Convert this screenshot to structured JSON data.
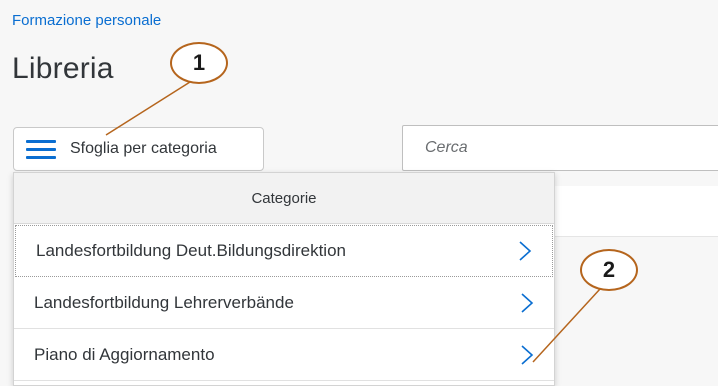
{
  "header": {
    "breadcrumb": "Formazione personale",
    "title": "Libreria"
  },
  "toolbar": {
    "browse_label": "Sfoglia per categoria",
    "search_placeholder": "Cerca"
  },
  "categories": {
    "header": "Categorie",
    "items": [
      {
        "label": "Landesfortbildung Deut.Bildungsdirektion"
      },
      {
        "label": "Landesfortbildung Lehrerverbände"
      },
      {
        "label": "Piano di Aggiornamento"
      }
    ]
  },
  "callouts": [
    {
      "number": "1"
    },
    {
      "number": "2"
    }
  ],
  "colors": {
    "link": "#0a6ed1",
    "text": "#32363a",
    "callout_line": "#b5651d"
  },
  "icons": {
    "browse": "hamburger-menu-icon",
    "item_arrow": "chevron-right-icon"
  }
}
